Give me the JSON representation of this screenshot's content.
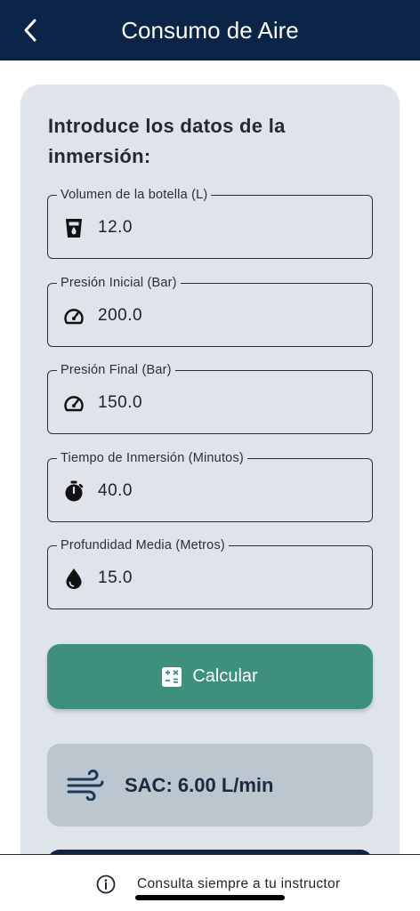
{
  "appbar": {
    "title": "Consumo de Aire"
  },
  "form": {
    "heading": "Introduce los datos de la inmersión:",
    "fields": [
      {
        "label": "Volumen de la botella (L)",
        "value": "12.0",
        "icon": "cup-icon"
      },
      {
        "label": "Presión Inicial (Bar)",
        "value": "200.0",
        "icon": "gauge-icon"
      },
      {
        "label": "Presión Final (Bar)",
        "value": "150.0",
        "icon": "gauge-icon"
      },
      {
        "label": "Tiempo de Inmersión (Minutos)",
        "value": "40.0",
        "icon": "timer-icon"
      },
      {
        "label": "Profundidad Media (Metros)",
        "value": "15.0",
        "icon": "water-drop-icon"
      }
    ]
  },
  "calculate_button": {
    "label": "Calcular",
    "icon": "calculator-icon",
    "color": "#3e907c"
  },
  "result": {
    "text": "SAC: 6.00 L/min",
    "icon": "wind-icon"
  },
  "footer": {
    "text": "Consulta siempre a tu instructor",
    "icon": "info-icon"
  },
  "colors": {
    "primary": "#0b2447",
    "card": "#dfe4ea",
    "result_bg": "#bcc6ce"
  }
}
